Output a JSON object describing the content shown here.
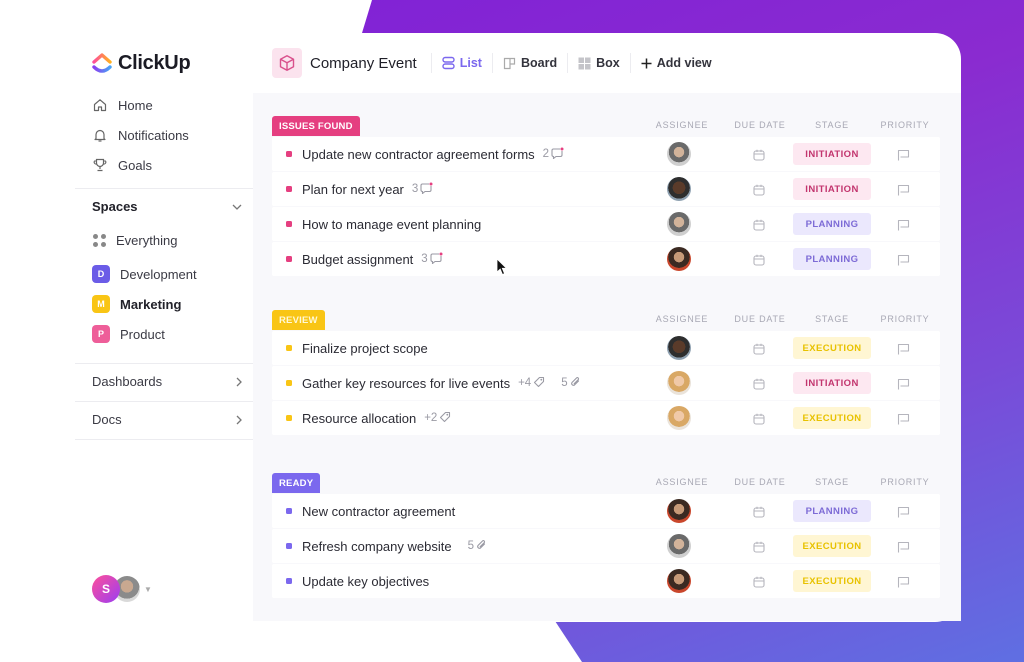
{
  "app": {
    "name": "ClickUp"
  },
  "colors": {
    "issues_found": "#e53f80",
    "review": "#f9c515",
    "ready": "#7b68ee",
    "accent": "#7b68ee",
    "development": "#6b5ce7",
    "marketing": "#f9c515",
    "product": "#ee5e99"
  },
  "sidebar": {
    "nav": [
      {
        "label": "Home",
        "icon": "home-icon"
      },
      {
        "label": "Notifications",
        "icon": "bell-icon"
      },
      {
        "label": "Goals",
        "icon": "trophy-icon"
      }
    ],
    "spaces_label": "Spaces",
    "everything_label": "Everything",
    "spaces": [
      {
        "badge": "D",
        "label": "Development"
      },
      {
        "badge": "M",
        "label": "Marketing"
      },
      {
        "badge": "P",
        "label": "Product"
      }
    ],
    "dashboards_label": "Dashboards",
    "docs_label": "Docs",
    "user_initial": "S"
  },
  "header": {
    "title": "Company Event",
    "views": [
      {
        "label": "List",
        "icon": "list-icon",
        "active": true
      },
      {
        "label": "Board",
        "icon": "board-icon"
      },
      {
        "label": "Box",
        "icon": "box-icon"
      }
    ],
    "add_view_label": "Add view"
  },
  "columns": {
    "assignee": "ASSIGNEE",
    "due_date": "DUE DATE",
    "stage": "STAGE",
    "priority": "PRIORITY"
  },
  "groups": [
    {
      "label": "ISSUES FOUND",
      "tasks": [
        {
          "name": "Update new contractor agreement forms",
          "comments": "2",
          "assignee": "a",
          "stage": "INITIATION"
        },
        {
          "name": "Plan for next year",
          "comments": "3",
          "assignee": "b",
          "stage": "INITIATION"
        },
        {
          "name": "How to manage event planning",
          "assignee": "a",
          "stage": "PLANNING"
        },
        {
          "name": "Budget assignment",
          "comments": "3",
          "assignee": "c",
          "stage": "PLANNING"
        }
      ]
    },
    {
      "label": "REVIEW",
      "tasks": [
        {
          "name": "Finalize project scope",
          "assignee": "b",
          "stage": "EXECUTION"
        },
        {
          "name": "Gather key resources for live events",
          "tags": "+4",
          "attachments": "5",
          "assignee": "d",
          "stage": "INITIATION"
        },
        {
          "name": "Resource allocation",
          "tags": "+2",
          "assignee": "d",
          "stage": "EXECUTION"
        }
      ]
    },
    {
      "label": "READY",
      "tasks": [
        {
          "name": "New contractor agreement",
          "assignee": "c",
          "stage": "PLANNING"
        },
        {
          "name": "Refresh company website",
          "attachments": "5",
          "assignee": "a",
          "stage": "EXECUTION"
        },
        {
          "name": "Update key objectives",
          "assignee": "c",
          "stage": "EXECUTION"
        }
      ]
    }
  ]
}
